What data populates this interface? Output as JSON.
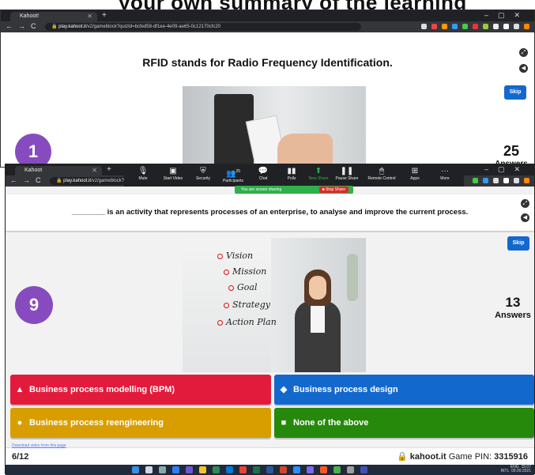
{
  "top_banner": {
    "fragment": "your own summary of the learning"
  },
  "back_window": {
    "tab_title": "Kahoot!",
    "url_host": "play.kahoot.it",
    "url_path": "/v2/gameblock?quizId=bcfed58-df1ee-4e09-ae65-0c12170cfc20",
    "question": "RFID stands for Radio Frequency Identification.",
    "skip_label": "Skip",
    "question_number": "1",
    "answers_count": "25",
    "answers_label": "Answers"
  },
  "front_window": {
    "tab_title": "Kahoot",
    "url_host": "play.kahoot.it",
    "url_path": "/v2/gameblock?quizId=bcfed58-df1ee-4e09-ae65-0c12170cfc20",
    "zoom_toolbar": [
      {
        "icon": "microphone-icon",
        "label": "Mute"
      },
      {
        "icon": "video-icon",
        "label": "Start Video"
      },
      {
        "icon": "shield-icon",
        "label": "Security"
      },
      {
        "icon": "participants-icon",
        "label": "Participants"
      },
      {
        "icon": "chat-icon",
        "label": "Chat"
      },
      {
        "icon": "polls-icon",
        "label": "Polls"
      },
      {
        "icon": "share-icon",
        "label": "New Share"
      },
      {
        "icon": "pause-icon",
        "label": "Pause Share"
      },
      {
        "icon": "remote-icon",
        "label": "Remote Control"
      },
      {
        "icon": "apps-icon",
        "label": "Apps"
      },
      {
        "icon": "more-icon",
        "label": "More"
      }
    ],
    "participants_count": "25",
    "screen_share_text": "You are screen sharing",
    "stop_share_label": "Stop Share",
    "question": "________ is an activity that represents processes of an enterprise, to analyse and improve the current process.",
    "skip_label": "Skip",
    "question_number": "9",
    "answers_count": "13",
    "answers_label": "Answers",
    "image_steps": [
      "Vision",
      "Mission",
      "Goal",
      "Strategy",
      "Action Plan"
    ],
    "answers": [
      {
        "shape": "▲",
        "text": "Business process modelling (BPM)",
        "color": "#e21b3c"
      },
      {
        "shape": "◆",
        "text": "Business process design",
        "color": "#1368ce"
      },
      {
        "shape": "●",
        "text": "Business process reengineering",
        "color": "#d89e00"
      },
      {
        "shape": "■",
        "text": "None of the above",
        "color": "#26890c"
      }
    ],
    "download_link": "Download video from this page",
    "progress": "6/12",
    "brand": "kahoot.it",
    "game_pin_label": "Game PIN:",
    "game_pin": "3315916",
    "tray_language": "ENG",
    "tray_region": "INTL",
    "tray_time": "15:07",
    "tray_date": "09.09.2021"
  },
  "colors": {
    "purple": "#864cbf",
    "kahoot_blue": "#1368ce"
  }
}
